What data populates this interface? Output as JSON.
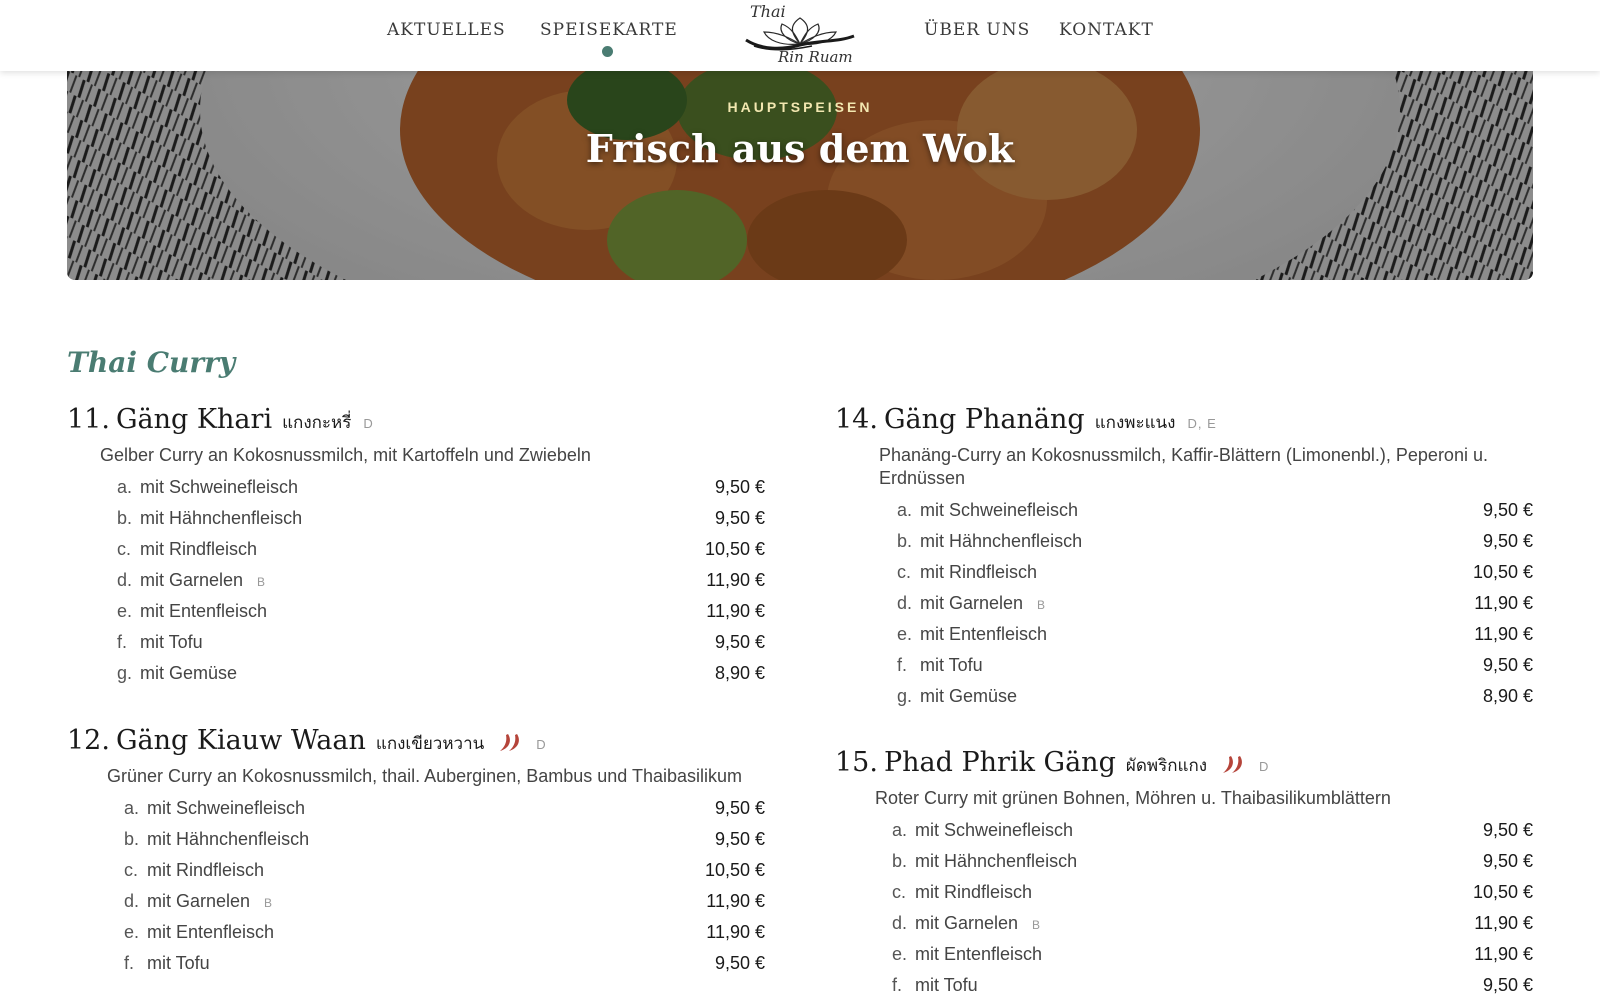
{
  "nav": {
    "links": [
      "AKTUELLES",
      "SPEISEKARTE",
      "ÜBER UNS",
      "KONTAKT"
    ],
    "active": "SPEISEKARTE",
    "logo_top": "Thai",
    "logo_bottom": "Rin Ruam"
  },
  "hero": {
    "kicker": "HAUPTSPEISEN",
    "title": "Frisch aus dem Wok"
  },
  "section": {
    "title": "Thai Curry"
  },
  "colors": {
    "accent": "#4a7c72",
    "kicker": "#f2e7b0",
    "chili": "#b5443a"
  },
  "dishes": [
    {
      "num": "11.",
      "name": "Gäng Khari",
      "thai": "แกงกะหรี่",
      "allergen": "D",
      "spicy": 0,
      "description": "Gelber Curry an Kokosnussmilch, mit Kartoffeln und Zwiebeln",
      "variants": [
        {
          "letter": "a.",
          "label": "mit Schweinefleisch",
          "allergen": "",
          "price": "9,50 €"
        },
        {
          "letter": "b.",
          "label": "mit Hähnchenfleisch",
          "allergen": "",
          "price": "9,50 €"
        },
        {
          "letter": "c.",
          "label": "mit Rindfleisch",
          "allergen": "",
          "price": "10,50 €"
        },
        {
          "letter": "d.",
          "label": "mit Garnelen",
          "allergen": "B",
          "price": "11,90 €"
        },
        {
          "letter": "e.",
          "label": "mit Entenfleisch",
          "allergen": "",
          "price": "11,90 €"
        },
        {
          "letter": "f.",
          "label": "mit Tofu",
          "allergen": "",
          "price": "9,50 €"
        },
        {
          "letter": "g.",
          "label": "mit Gemüse",
          "allergen": "",
          "price": "8,90 €"
        }
      ]
    },
    {
      "num": "12.",
      "name": "Gäng Kiauw Waan",
      "thai": "แกงเขียวหวาน",
      "allergen": "D",
      "spicy": 2,
      "description": "Grüner Curry an Kokosnussmilch, thail. Auberginen, Bambus und Thaibasilikum",
      "variants": [
        {
          "letter": "a.",
          "label": "mit Schweinefleisch",
          "allergen": "",
          "price": "9,50 €"
        },
        {
          "letter": "b.",
          "label": "mit Hähnchenfleisch",
          "allergen": "",
          "price": "9,50 €"
        },
        {
          "letter": "c.",
          "label": "mit Rindfleisch",
          "allergen": "",
          "price": "10,50 €"
        },
        {
          "letter": "d.",
          "label": "mit Garnelen",
          "allergen": "B",
          "price": "11,90 €"
        },
        {
          "letter": "e.",
          "label": "mit Entenfleisch",
          "allergen": "",
          "price": "11,90 €"
        },
        {
          "letter": "f.",
          "label": "mit Tofu",
          "allergen": "",
          "price": "9,50 €"
        }
      ]
    },
    {
      "num": "14.",
      "name": "Gäng Phanäng",
      "thai": "แกงพะแนง",
      "allergen": "D, E",
      "spicy": 0,
      "description": "Phanäng-Curry an Kokosnussmilch, Kaffir-Blättern (Limonenbl.), Peperoni u. Erdnüssen",
      "variants": [
        {
          "letter": "a.",
          "label": "mit Schweinefleisch",
          "allergen": "",
          "price": "9,50 €"
        },
        {
          "letter": "b.",
          "label": "mit Hähnchenfleisch",
          "allergen": "",
          "price": "9,50 €"
        },
        {
          "letter": "c.",
          "label": "mit Rindfleisch",
          "allergen": "",
          "price": "10,50 €"
        },
        {
          "letter": "d.",
          "label": "mit Garnelen",
          "allergen": "B",
          "price": "11,90 €"
        },
        {
          "letter": "e.",
          "label": "mit Entenfleisch",
          "allergen": "",
          "price": "11,90 €"
        },
        {
          "letter": "f.",
          "label": "mit Tofu",
          "allergen": "",
          "price": "9,50 €"
        },
        {
          "letter": "g.",
          "label": "mit Gemüse",
          "allergen": "",
          "price": "8,90 €"
        }
      ]
    },
    {
      "num": "15.",
      "name": "Phad Phrik Gäng",
      "thai": "ผัดพริกแกง",
      "allergen": "D",
      "spicy": 2,
      "description": "Roter Curry mit grünen Bohnen, Möhren u. Thaibasilikumblättern",
      "variants": [
        {
          "letter": "a.",
          "label": "mit Schweinefleisch",
          "allergen": "",
          "price": "9,50 €"
        },
        {
          "letter": "b.",
          "label": "mit Hähnchenfleisch",
          "allergen": "",
          "price": "9,50 €"
        },
        {
          "letter": "c.",
          "label": "mit Rindfleisch",
          "allergen": "",
          "price": "10,50 €"
        },
        {
          "letter": "d.",
          "label": "mit Garnelen",
          "allergen": "B",
          "price": "11,90 €"
        },
        {
          "letter": "e.",
          "label": "mit Entenfleisch",
          "allergen": "",
          "price": "11,90 €"
        },
        {
          "letter": "f.",
          "label": "mit Tofu",
          "allergen": "",
          "price": "9,50 €"
        }
      ]
    }
  ]
}
